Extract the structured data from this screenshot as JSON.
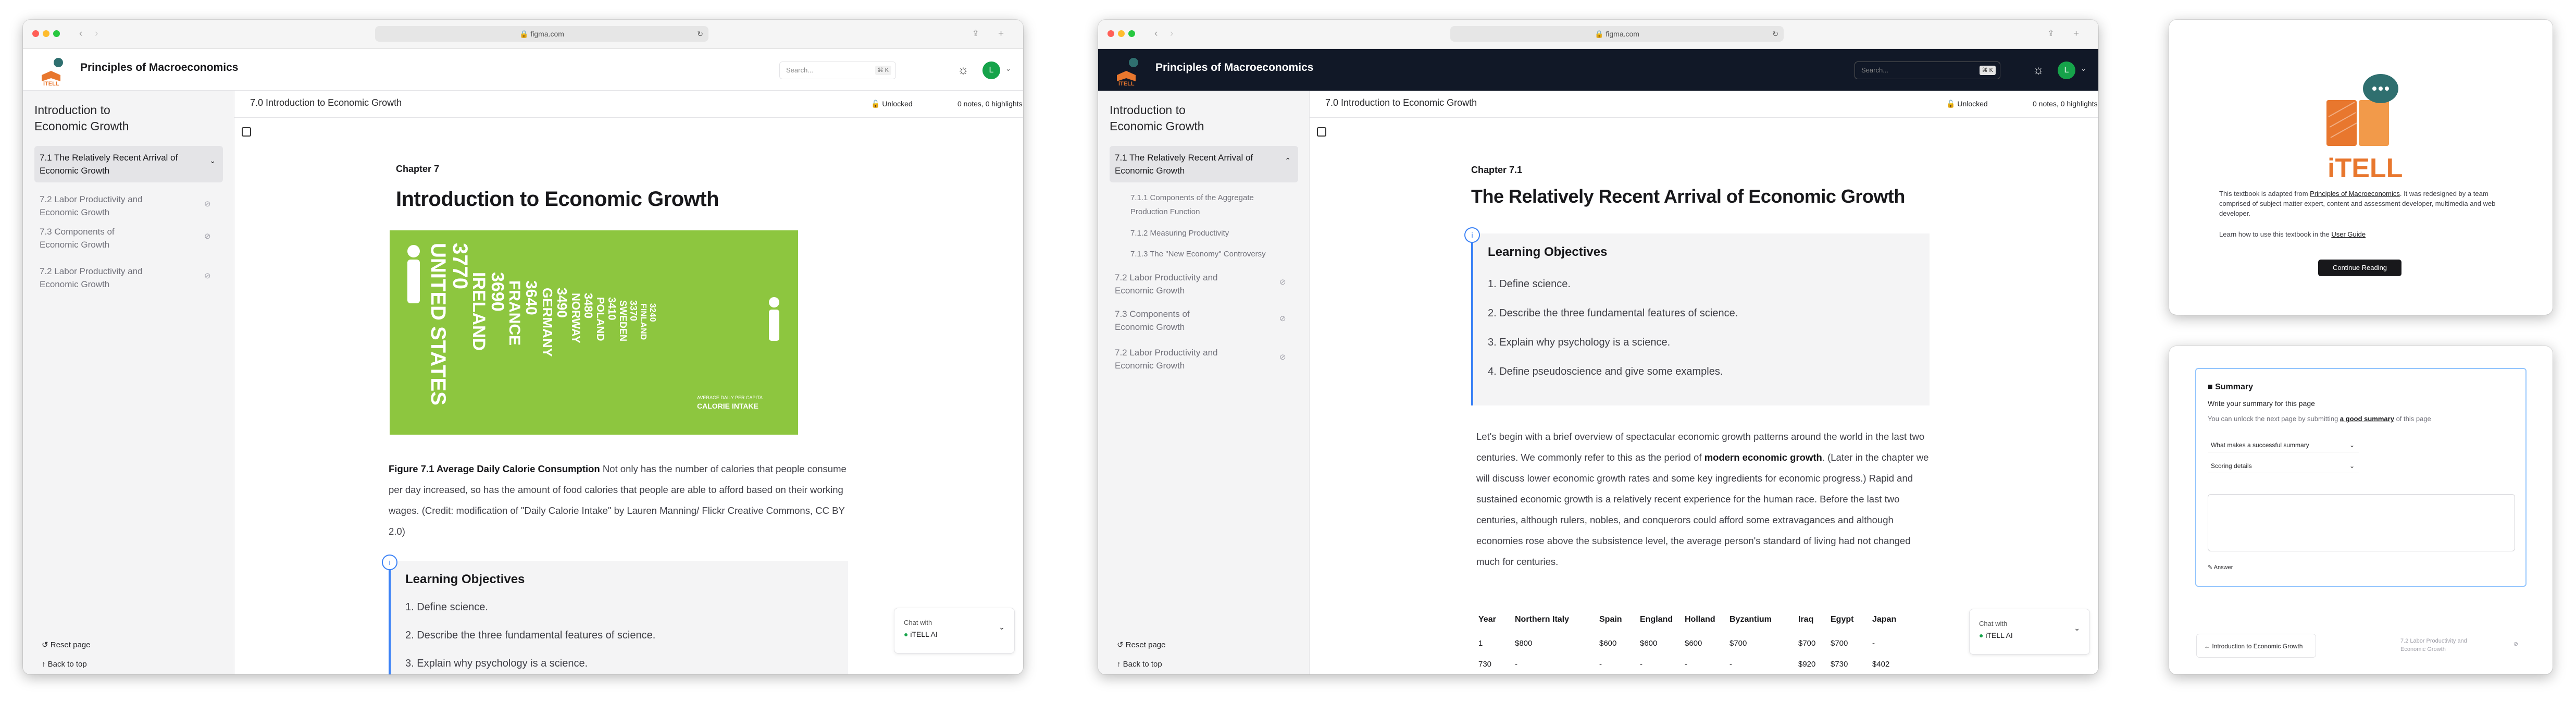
{
  "window1": {
    "url": "figma.com",
    "app_title": "Principles of Macroeconomics",
    "search_placeholder": "Search...",
    "search_shortcut": "⌘ K",
    "avatar_letter": "L",
    "sidebar": {
      "title": "Introduction to Economic Growth",
      "active_item": "7.1 The Relatively Recent Arrival of Economic Growth",
      "items": [
        "7.2 Labor Productivity and Economic Growth",
        "7.3 Components of Economic Growth",
        "7.2 Labor Productivity and Economic Growth"
      ],
      "reset_label": "Reset page",
      "back_label": "Back to top"
    },
    "breadcrumb": "7.0 Introduction to Economic Growth",
    "unlocked": "Unlocked",
    "notes": "0 notes, 0 highlights",
    "chapter": "Chapter 7",
    "heading": "Introduction to Economic Growth",
    "figure": {
      "countries": [
        "UNITED STATES",
        "IRELAND",
        "FRANCE",
        "GERMANY",
        "NORWAY",
        "POLAND",
        "SWEDEN",
        "FINLAND"
      ],
      "values": [
        "3770",
        "3690",
        "3640",
        "3490",
        "3480",
        "3410",
        "3370",
        "3240"
      ],
      "caption_small": "AVERAGE DAILY PER CAPITA",
      "caption_big": "CALORIE INTAKE"
    },
    "caption_bold": "Figure 7.1 Average Daily Calorie Consumption",
    "caption_text": " Not only has the number of calories that people consume per day increased, so has the amount of food calories that people are able to afford based on their working wages. (Credit: modification of \"Daily Calorie Intake\" by Lauren Manning/ Flickr Creative Commons, CC BY 2.0)",
    "lo_number": "i",
    "lo_title": "Learning Objectives",
    "lo_items": [
      "1. Define science.",
      "2. Describe the three fundamental features of science.",
      "3. Explain why psychology is a science."
    ],
    "chat_label": "Chat with",
    "chat_name": "iTELL AI"
  },
  "window2": {
    "url": "figma.com",
    "app_title": "Principles of Macroeconomics",
    "search_placeholder": "Search...",
    "search_shortcut": "⌘ K",
    "avatar_letter": "L",
    "sidebar": {
      "title": "Introduction to Economic Growth",
      "active_item": "7.1 The Relatively Recent Arrival of Economic Growth",
      "subitems": [
        "7.1.1 Components of the Aggregate Production Function",
        "7.1.2 Measuring Productivity",
        "7.1.3 The \"New Economy\" Controversy"
      ],
      "items": [
        "7.2 Labor Productivity and Economic Growth",
        "7.3 Components of Economic Growth",
        "7.2 Labor Productivity and Economic Growth"
      ],
      "reset_label": "Reset page",
      "back_label": "Back to top"
    },
    "breadcrumb": "7.0 Introduction to Economic Growth",
    "unlocked": "Unlocked",
    "notes": "0 notes, 0 highlights",
    "chapter": "Chapter 7.1",
    "heading": "The Relatively Recent Arrival of Economic Growth",
    "lo_number": "i",
    "lo_title": "Learning Objectives",
    "lo_items": [
      "1. Define science.",
      "2. Describe the three fundamental features of science.",
      "3. Explain why psychology is a science.",
      "4. Define pseudoscience and give some examples."
    ],
    "para_a": "Let's begin with a brief overview of spectacular economic growth patterns around the world in the last two centuries. We commonly refer to this as the period of ",
    "para_bold": "modern economic growth",
    "para_b": ". (Later in the chapter we will discuss lower economic growth rates and some key ingredients for economic progress.) Rapid and sustained economic growth is a relatively recent experience for the human race. Before the last two centuries, although rulers, nobles, and conquerors could afford some extravagances and although economies rose above the subsistence level, the average person's standard of living had not changed much for centuries.",
    "table": {
      "headers": [
        "Year",
        "Northern Italy",
        "Spain",
        "England",
        "Holland",
        "Byzantium",
        "Iraq",
        "Egypt",
        "Japan"
      ],
      "rows": [
        [
          "1",
          "$800",
          "$600",
          "$600",
          "$600",
          "$700",
          "$700",
          "$700",
          "-"
        ],
        [
          "730",
          "-",
          "-",
          "-",
          "-",
          "-",
          "$920",
          "$730",
          "$402"
        ]
      ]
    },
    "chat_label": "Chat with",
    "chat_name": "iTELL AI"
  },
  "window3": {
    "logo_text": "iTELL",
    "text_a": "This textbook is adapted from ",
    "text_link": "Principles of Macroeconomics",
    "text_b": ". It was redesigned by a team comprised of subject matter expert, content and assessment developer, multimedia and web developer.",
    "guide_a": "Learn how to use this textbook in the ",
    "guide_link": "User Guide",
    "button": "Continue Reading"
  },
  "window4": {
    "summary_title": "Summary",
    "summary_prompt": "Write your summary for this page",
    "unlock_a": "You can unlock the next page by submitting ",
    "unlock_link": "a good summary",
    "unlock_b": " of this page",
    "select1": "What makes a successful summary",
    "select2": "Scoring details",
    "answer_label": "Answer",
    "prev_label": "← Introduction to Economic Growth",
    "next_label": "7.2 Labor Productivity and Economic Growth"
  },
  "colors": {
    "accent": "#3b82f6",
    "dark_header": "#111827",
    "avatar": "#16a34a",
    "itell_orange": "#e8772e",
    "figure_green": "#8dc63f"
  }
}
